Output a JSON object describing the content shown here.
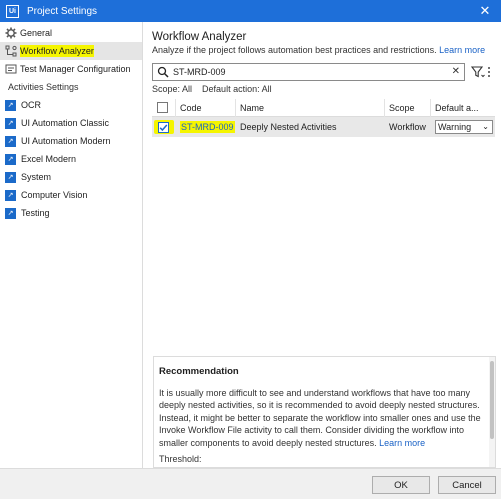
{
  "window": {
    "title": "Project Settings",
    "app_icon_text": "Ui",
    "close_glyph": "✕"
  },
  "sidebar": {
    "items": [
      {
        "label": "General"
      },
      {
        "label": "Workflow Analyzer"
      },
      {
        "label": "Test Manager Configuration"
      }
    ],
    "section_label": "Activities Settings",
    "activities": [
      {
        "label": "OCR"
      },
      {
        "label": "UI Automation Classic"
      },
      {
        "label": "UI Automation Modern"
      },
      {
        "label": "Excel Modern"
      },
      {
        "label": "System"
      },
      {
        "label": "Computer Vision"
      },
      {
        "label": "Testing"
      }
    ]
  },
  "main": {
    "title": "Workflow Analyzer",
    "description": "Analyze if the project follows automation best practices and restrictions.",
    "learn_more": "Learn more",
    "search_value": "ST-MRD-009",
    "scope_text": "Scope: All",
    "default_action_text": "Default action: All",
    "table": {
      "headers": {
        "code": "Code",
        "name": "Name",
        "scope": "Scope",
        "default_action": "Default a..."
      },
      "rows": [
        {
          "code": "ST-MRD-009",
          "name": "Deeply Nested Activities",
          "scope": "Workflow",
          "action": "Warning",
          "checked": true
        }
      ]
    },
    "recommendation": {
      "title": "Recommendation",
      "text": "It is usually more difficult to see and understand workflows that have too many deeply nested activities, so it is recommended to avoid deeply nested structures. Instead, it might be better to separate the workflow into smaller ones and use the Invoke Workflow File activity to call them. Consider dividing the workflow into smaller components to avoid deeply nested structures.",
      "learn_more": "Learn more",
      "threshold_label": "Threshold:"
    }
  },
  "footer": {
    "ok": "OK",
    "cancel": "Cancel"
  },
  "colors": {
    "titlebar": "#1e6fd9",
    "highlight": "#f5f500",
    "accent": "#1b6ac9"
  }
}
